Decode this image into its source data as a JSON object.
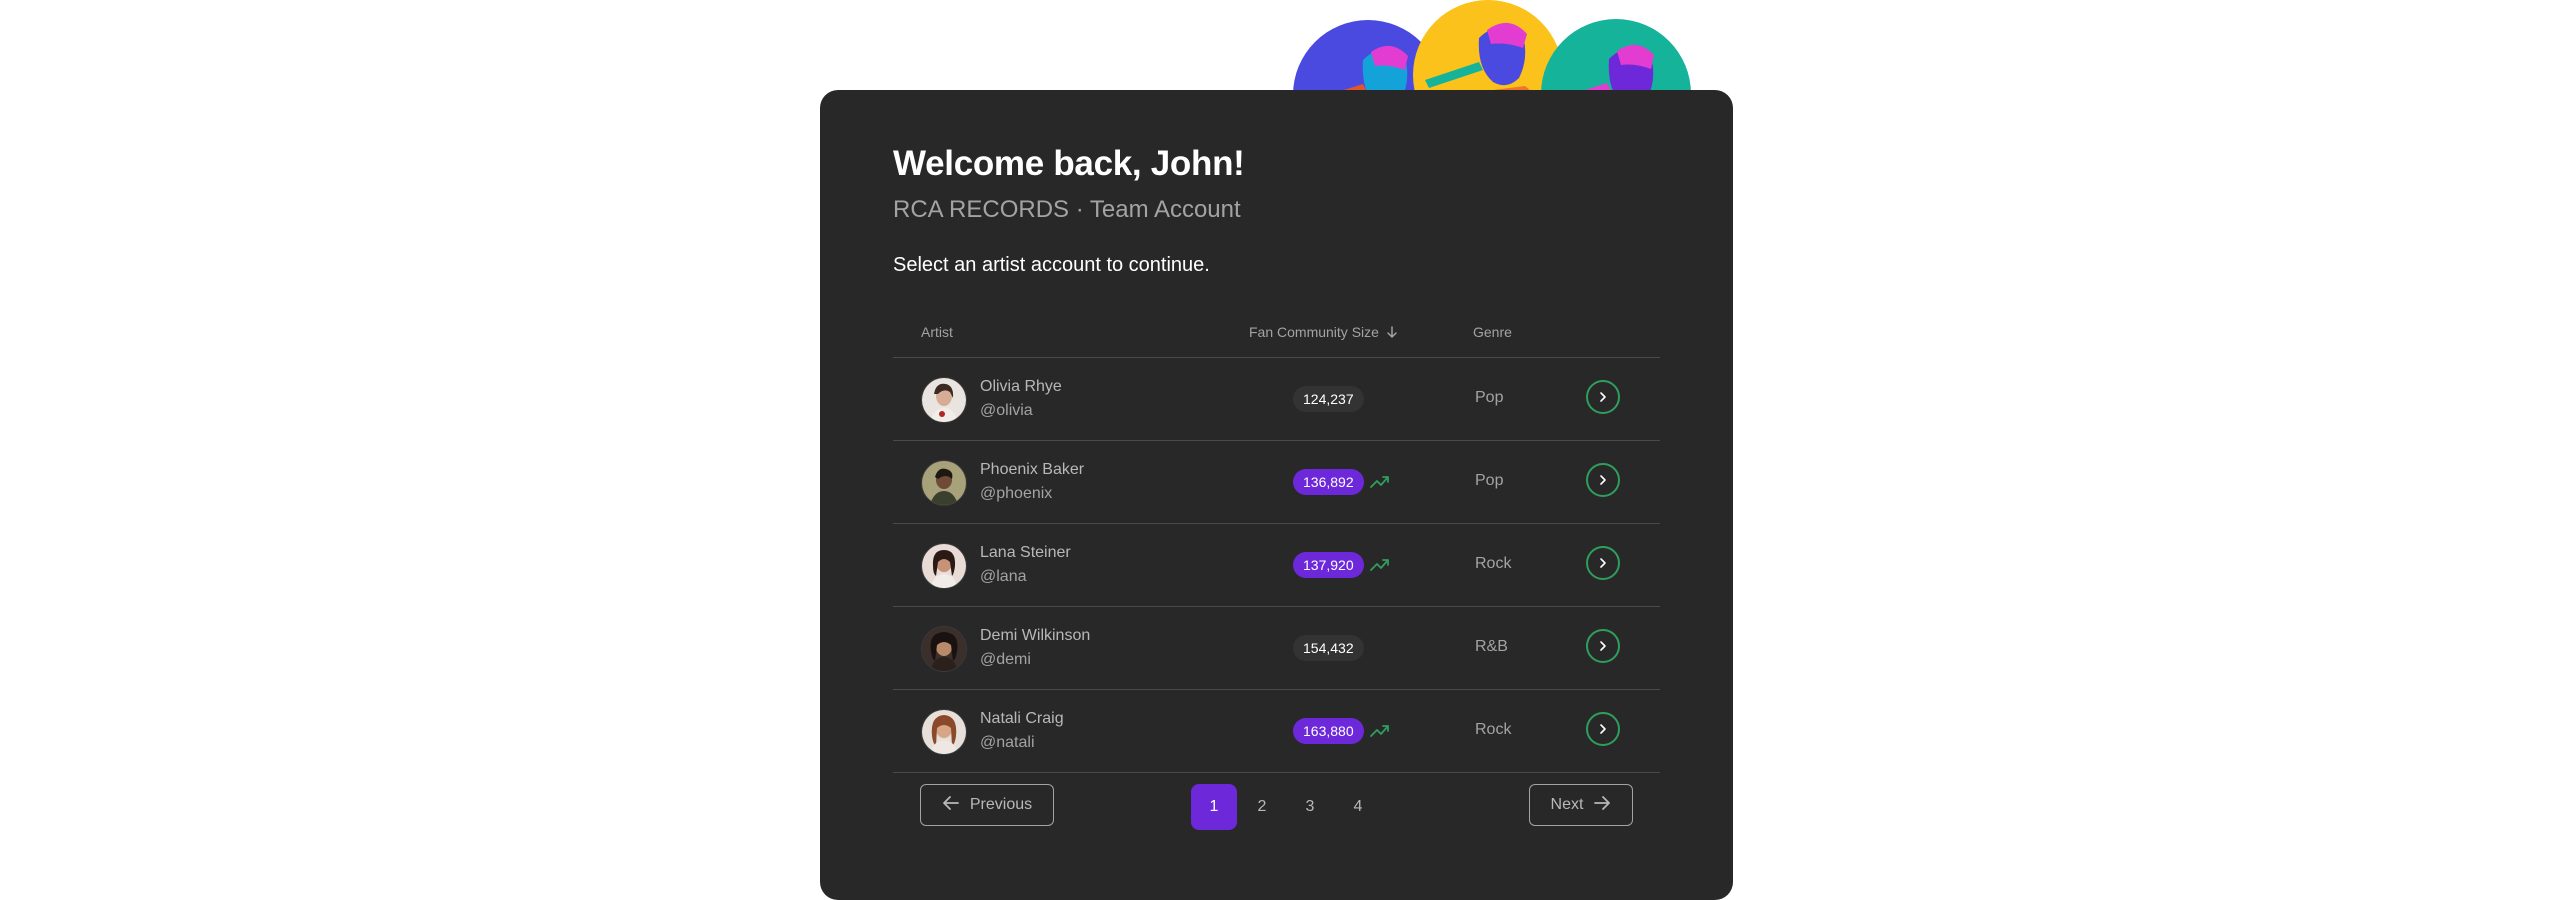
{
  "header": {
    "title": "Welcome back, John!",
    "subtitle": "RCA RECORDS · Team Account",
    "prompt": "Select an artist account to continue."
  },
  "table": {
    "columns": {
      "artist": "Artist",
      "fans": "Fan Community Size",
      "genre": "Genre"
    },
    "sort_icon": "arrow-down-icon",
    "rows": [
      {
        "name": "Olivia Rhye",
        "handle": "@olivia",
        "fans": "124,237",
        "trending": false,
        "genre": "Pop"
      },
      {
        "name": "Phoenix Baker",
        "handle": "@phoenix",
        "fans": "136,892",
        "trending": true,
        "genre": "Pop"
      },
      {
        "name": "Lana Steiner",
        "handle": "@lana",
        "fans": "137,920",
        "trending": true,
        "genre": "Rock"
      },
      {
        "name": "Demi Wilkinson",
        "handle": "@demi",
        "fans": "154,432",
        "trending": false,
        "genre": "R&B"
      },
      {
        "name": "Natali Craig",
        "handle": "@natali",
        "fans": "163,880",
        "trending": true,
        "genre": "Rock"
      }
    ]
  },
  "pagination": {
    "previous_label": "Previous",
    "next_label": "Next",
    "pages": [
      "1",
      "2",
      "3",
      "4"
    ],
    "current": "1"
  },
  "colors": {
    "card_bg": "#282828",
    "accent_purple": "#6d28d9",
    "accent_green": "#2f9e5d",
    "deco_blue": "#4a49e0",
    "deco_yellow": "#fbc21c",
    "deco_teal": "#15b39a"
  }
}
